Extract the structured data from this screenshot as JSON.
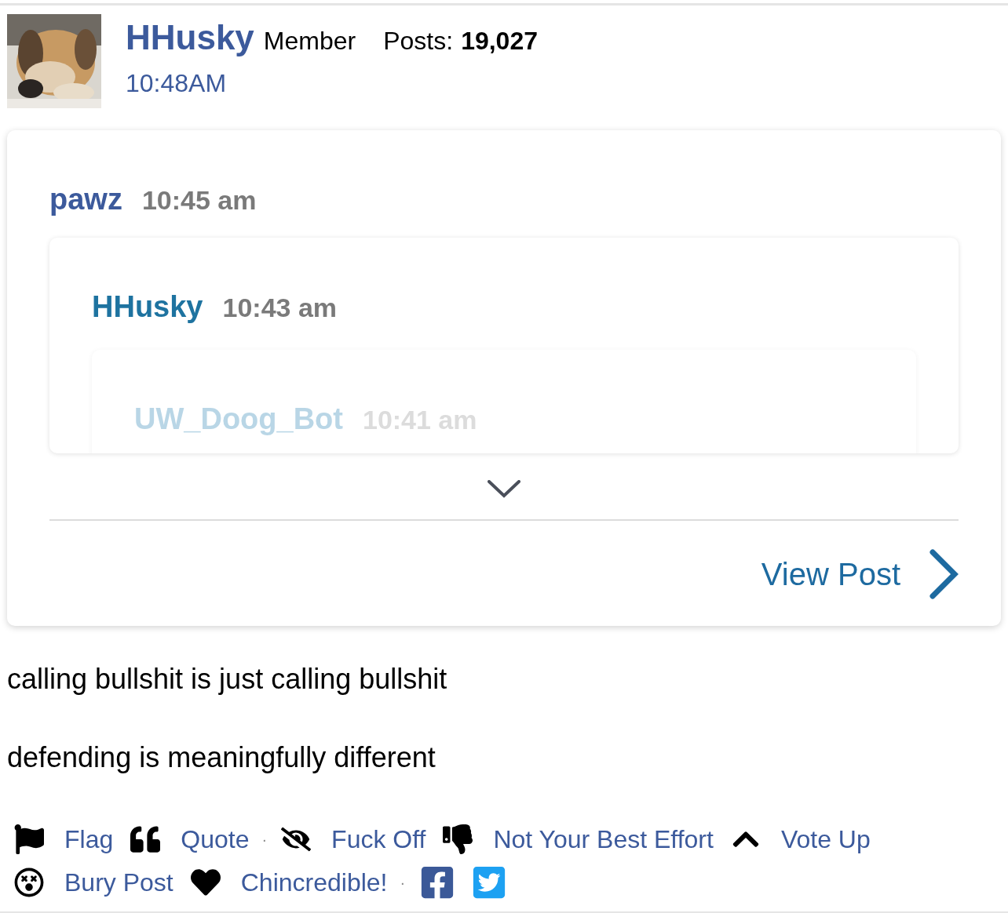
{
  "post": {
    "author": "HHusky",
    "role": "Member",
    "posts_label": "Posts:",
    "posts_count": "19,027",
    "time": "10:48AM"
  },
  "quote": {
    "author": "pawz",
    "time": "10:45 am",
    "nested": {
      "author": "HHusky",
      "time": "10:43 am",
      "nested": {
        "author": "UW_Doog_Bot",
        "time": "10:41 am"
      }
    },
    "view_post": "View Post"
  },
  "body": [
    "calling bullshit is just calling bullshit",
    "defending is meaningfully different"
  ],
  "actions": [
    {
      "kind": "link",
      "label": "Flag"
    },
    {
      "kind": "link",
      "label": "Quote"
    },
    {
      "kind": "separator",
      "label": "·"
    },
    {
      "kind": "link",
      "label": "Fuck Off"
    },
    {
      "kind": "link",
      "label": "Not Your Best Effort"
    },
    {
      "kind": "link",
      "label": "Vote Up"
    },
    {
      "kind": "link",
      "label": "Bury Post"
    },
    {
      "kind": "link",
      "label": "Chincredible!"
    },
    {
      "kind": "separator",
      "label": "·"
    },
    {
      "kind": "share"
    },
    {
      "kind": "share"
    }
  ]
}
